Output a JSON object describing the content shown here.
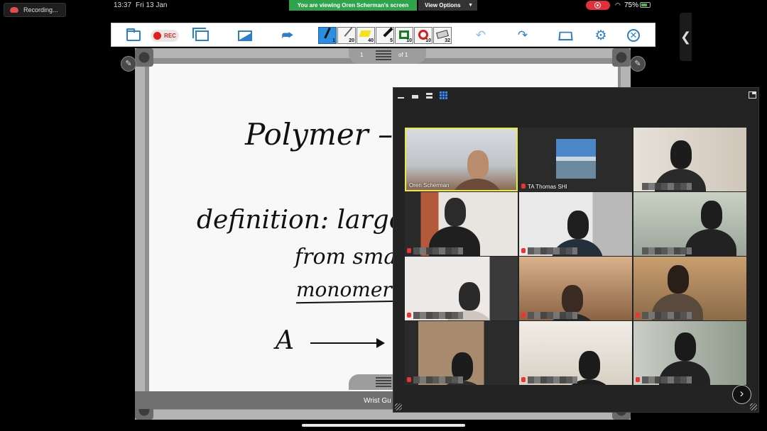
{
  "status_bar": {
    "time": "13:37",
    "date": "Fri 13 Jan",
    "share_banner": "You are viewing Oren Scherman's screen",
    "view_options": "View Options",
    "battery": "75%",
    "battery_level": 0.75
  },
  "recording_label": "Recording...",
  "toolbar": {
    "rec_label": "REC",
    "pen_size": "1",
    "pencil_size": "20",
    "highlighter_size": "40",
    "marker_size": "5",
    "rect_size": "10",
    "circle_size": "10",
    "eraser_size": "32"
  },
  "whiteboard": {
    "current_page": "1",
    "page_count": "of 1",
    "lines": {
      "title": "Polymer – m",
      "definition": "definition: large r",
      "from": "from sma",
      "monomer": "monomer",
      "reaction": "A"
    },
    "footer_label": "Wrist Gu"
  },
  "gallery": {
    "participants": [
      {
        "name": "Oren Scherman",
        "active": true,
        "muted": false
      },
      {
        "name": "TA Thomas SHI",
        "active": false,
        "muted": true
      },
      {
        "name": "",
        "active": false,
        "muted": false
      },
      {
        "name": "",
        "active": false,
        "muted": true
      },
      {
        "name": "",
        "active": false,
        "muted": true
      },
      {
        "name": "",
        "active": false,
        "muted": false
      },
      {
        "name": "",
        "active": false,
        "muted": true
      },
      {
        "name": "",
        "active": false,
        "muted": true
      },
      {
        "name": "",
        "active": false,
        "muted": true
      },
      {
        "name": "",
        "active": false,
        "muted": true
      },
      {
        "name": "",
        "active": false,
        "muted": true
      },
      {
        "name": "",
        "active": false,
        "muted": true
      }
    ]
  },
  "colors": {
    "accent": "#2c7fc9",
    "share_banner": "#2ea54a",
    "record": "#e0313a",
    "active_speaker": "#e8e84a"
  }
}
